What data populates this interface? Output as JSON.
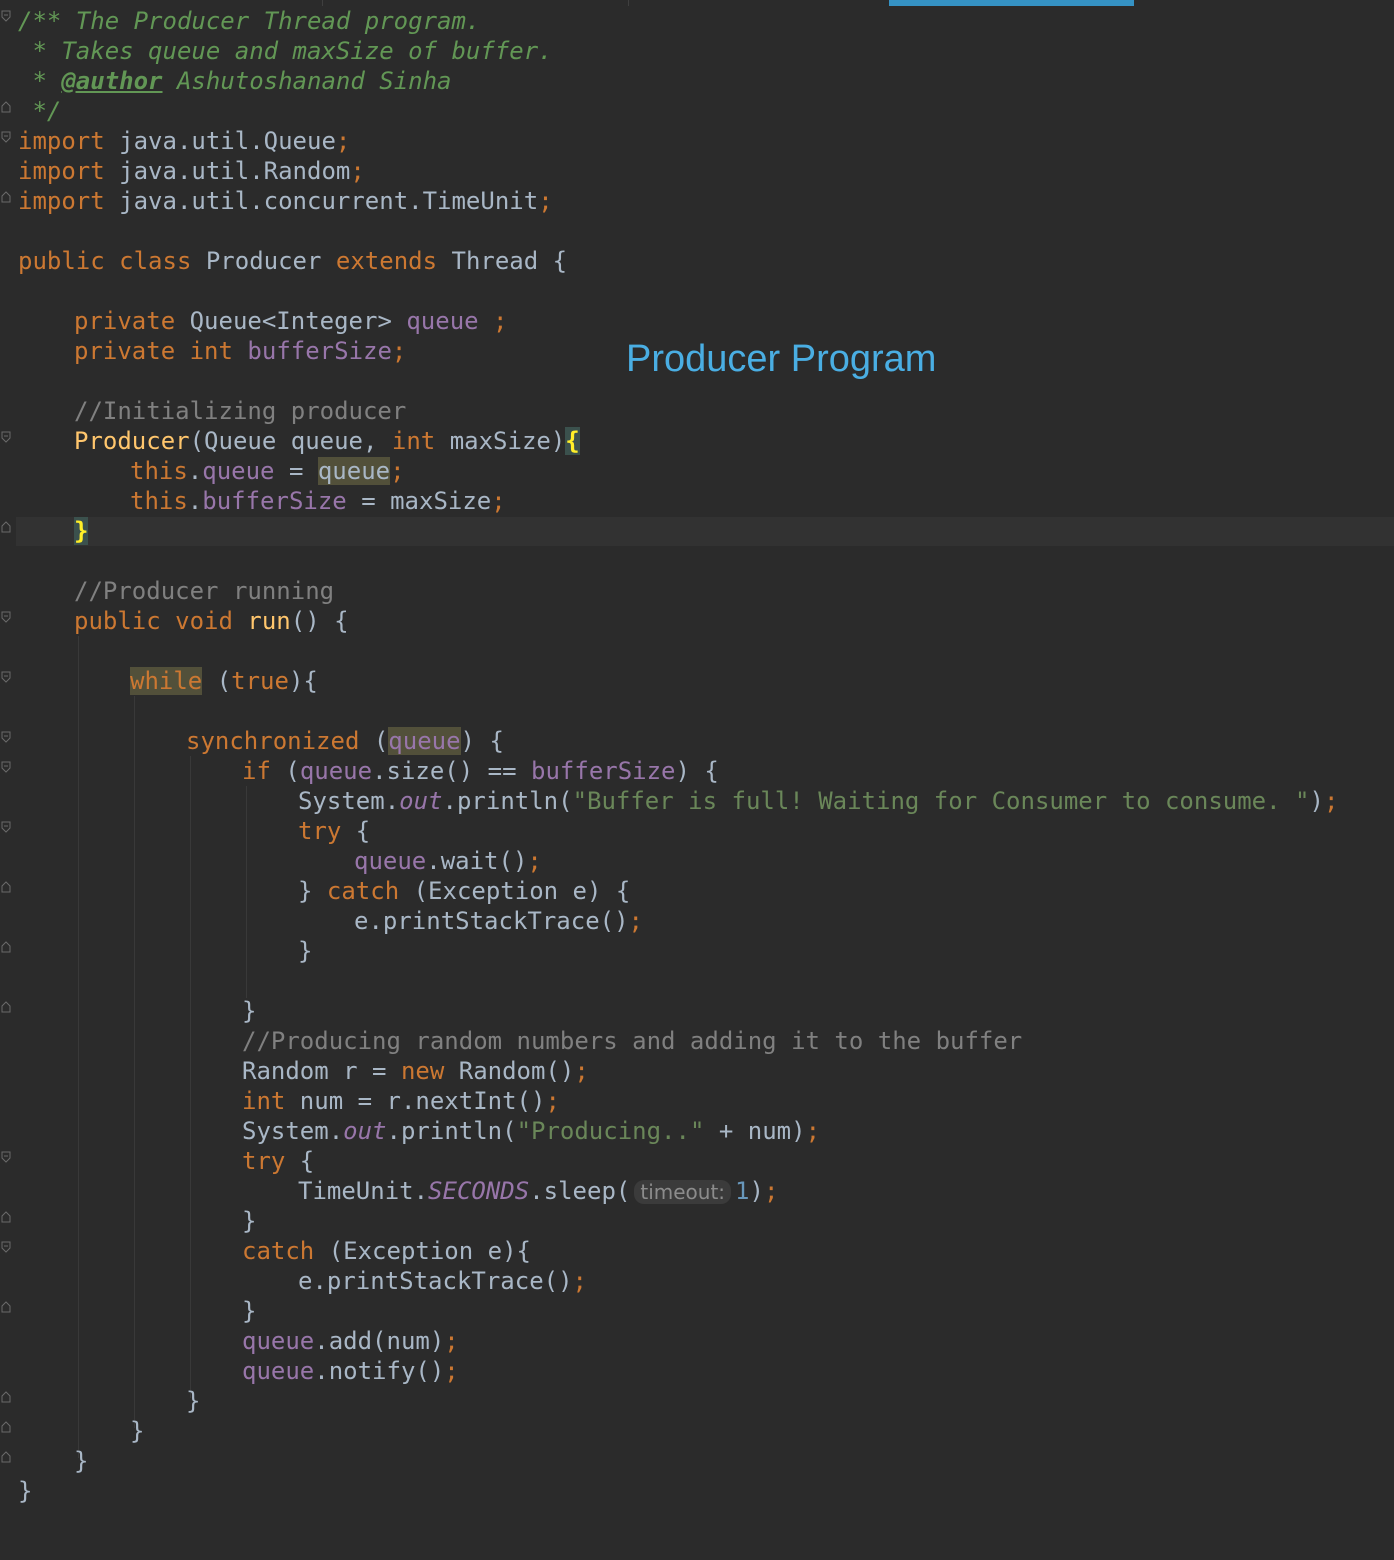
{
  "overlay_title": "Producer Program",
  "colors": {
    "background": "#2b2b2b",
    "keyword": "#cc7832",
    "comment": "#808080",
    "doc_comment": "#629755",
    "field": "#9876aa",
    "string": "#6a8759",
    "number": "#6897bb",
    "method_decl": "#ffc66d",
    "text": "#a9b7c6",
    "overlay_title": "#4aaee3",
    "active_tab": "#3592c4"
  },
  "code": {
    "doc_line1": "/** The Producer Thread program.",
    "doc_line2_prefix": " * Takes queue and maxSize of buffer.",
    "doc_line3_prefix": " * ",
    "doc_author_tag": "@author",
    "doc_author_name": " Ashutoshanand Sinha",
    "doc_line4": " */",
    "kw_import": "import",
    "import1": " java.util.Queue",
    "import2": " java.util.Random",
    "import3": " java.util.concurrent.TimeUnit",
    "semicolon": ";",
    "class_kw": "public class",
    "class_name": " Producer ",
    "extends_kw": "extends",
    "class_tail": " Thread {",
    "kw_private": "private",
    "field1_type": " Queue<Integer> ",
    "field1_name": "queue",
    "field1_tail": " ;",
    "kw_int": "int",
    "field2_name": "bufferSize",
    "comment_init": "//Initializing producer",
    "ctor_name": "Producer",
    "ctor_params_a": "(Queue queue, ",
    "ctor_params_b": " maxSize)",
    "open_brace": "{",
    "close_brace": "}",
    "kw_this": "this",
    "dot": ".",
    "assign": " = ",
    "param_queue": "queue",
    "param_maxsize": "maxSize",
    "comment_run": "//Producer running",
    "kw_public_void": "public void",
    "run_name": "run",
    "run_tail": "() {",
    "kw_while": "while",
    "while_tail_a": " (",
    "kw_true": "true",
    "while_tail_b": "){",
    "kw_synchronized": "synchronized",
    "sync_tail": ") {",
    "kw_if": "if",
    "if_mid": ".size() == ",
    "if_tail": ") {",
    "system": "System.",
    "out": "out",
    "println_open": ".println(",
    "str_buffer_full": "\"Buffer is full! Waiting for Consumer to consume. \"",
    "paren_close": ")",
    "kw_try": "try",
    "try_tail": " {",
    "wait_call": ".wait()",
    "catch_head": "} ",
    "kw_catch": "catch",
    "catch_tail": " (Exception e) {",
    "catch2_tail": " (Exception e){",
    "print_stack": "e.printStackTrace()",
    "comment_producing": "//Producing random numbers and adding it to the buffer",
    "random_decl": "Random r = ",
    "kw_new": "new",
    "random_ctor": " Random()",
    "num_decl": " num = r.nextInt()",
    "str_producing": "\"Producing..\"",
    "plus_num": " + num)",
    "timeunit": "TimeUnit.",
    "seconds": "SECONDS",
    "sleep_open": ".sleep(",
    "hint_timeout": "timeout:",
    "sleep_arg": "1",
    "add_call": ".add(num)",
    "notify_call": ".notify()"
  }
}
